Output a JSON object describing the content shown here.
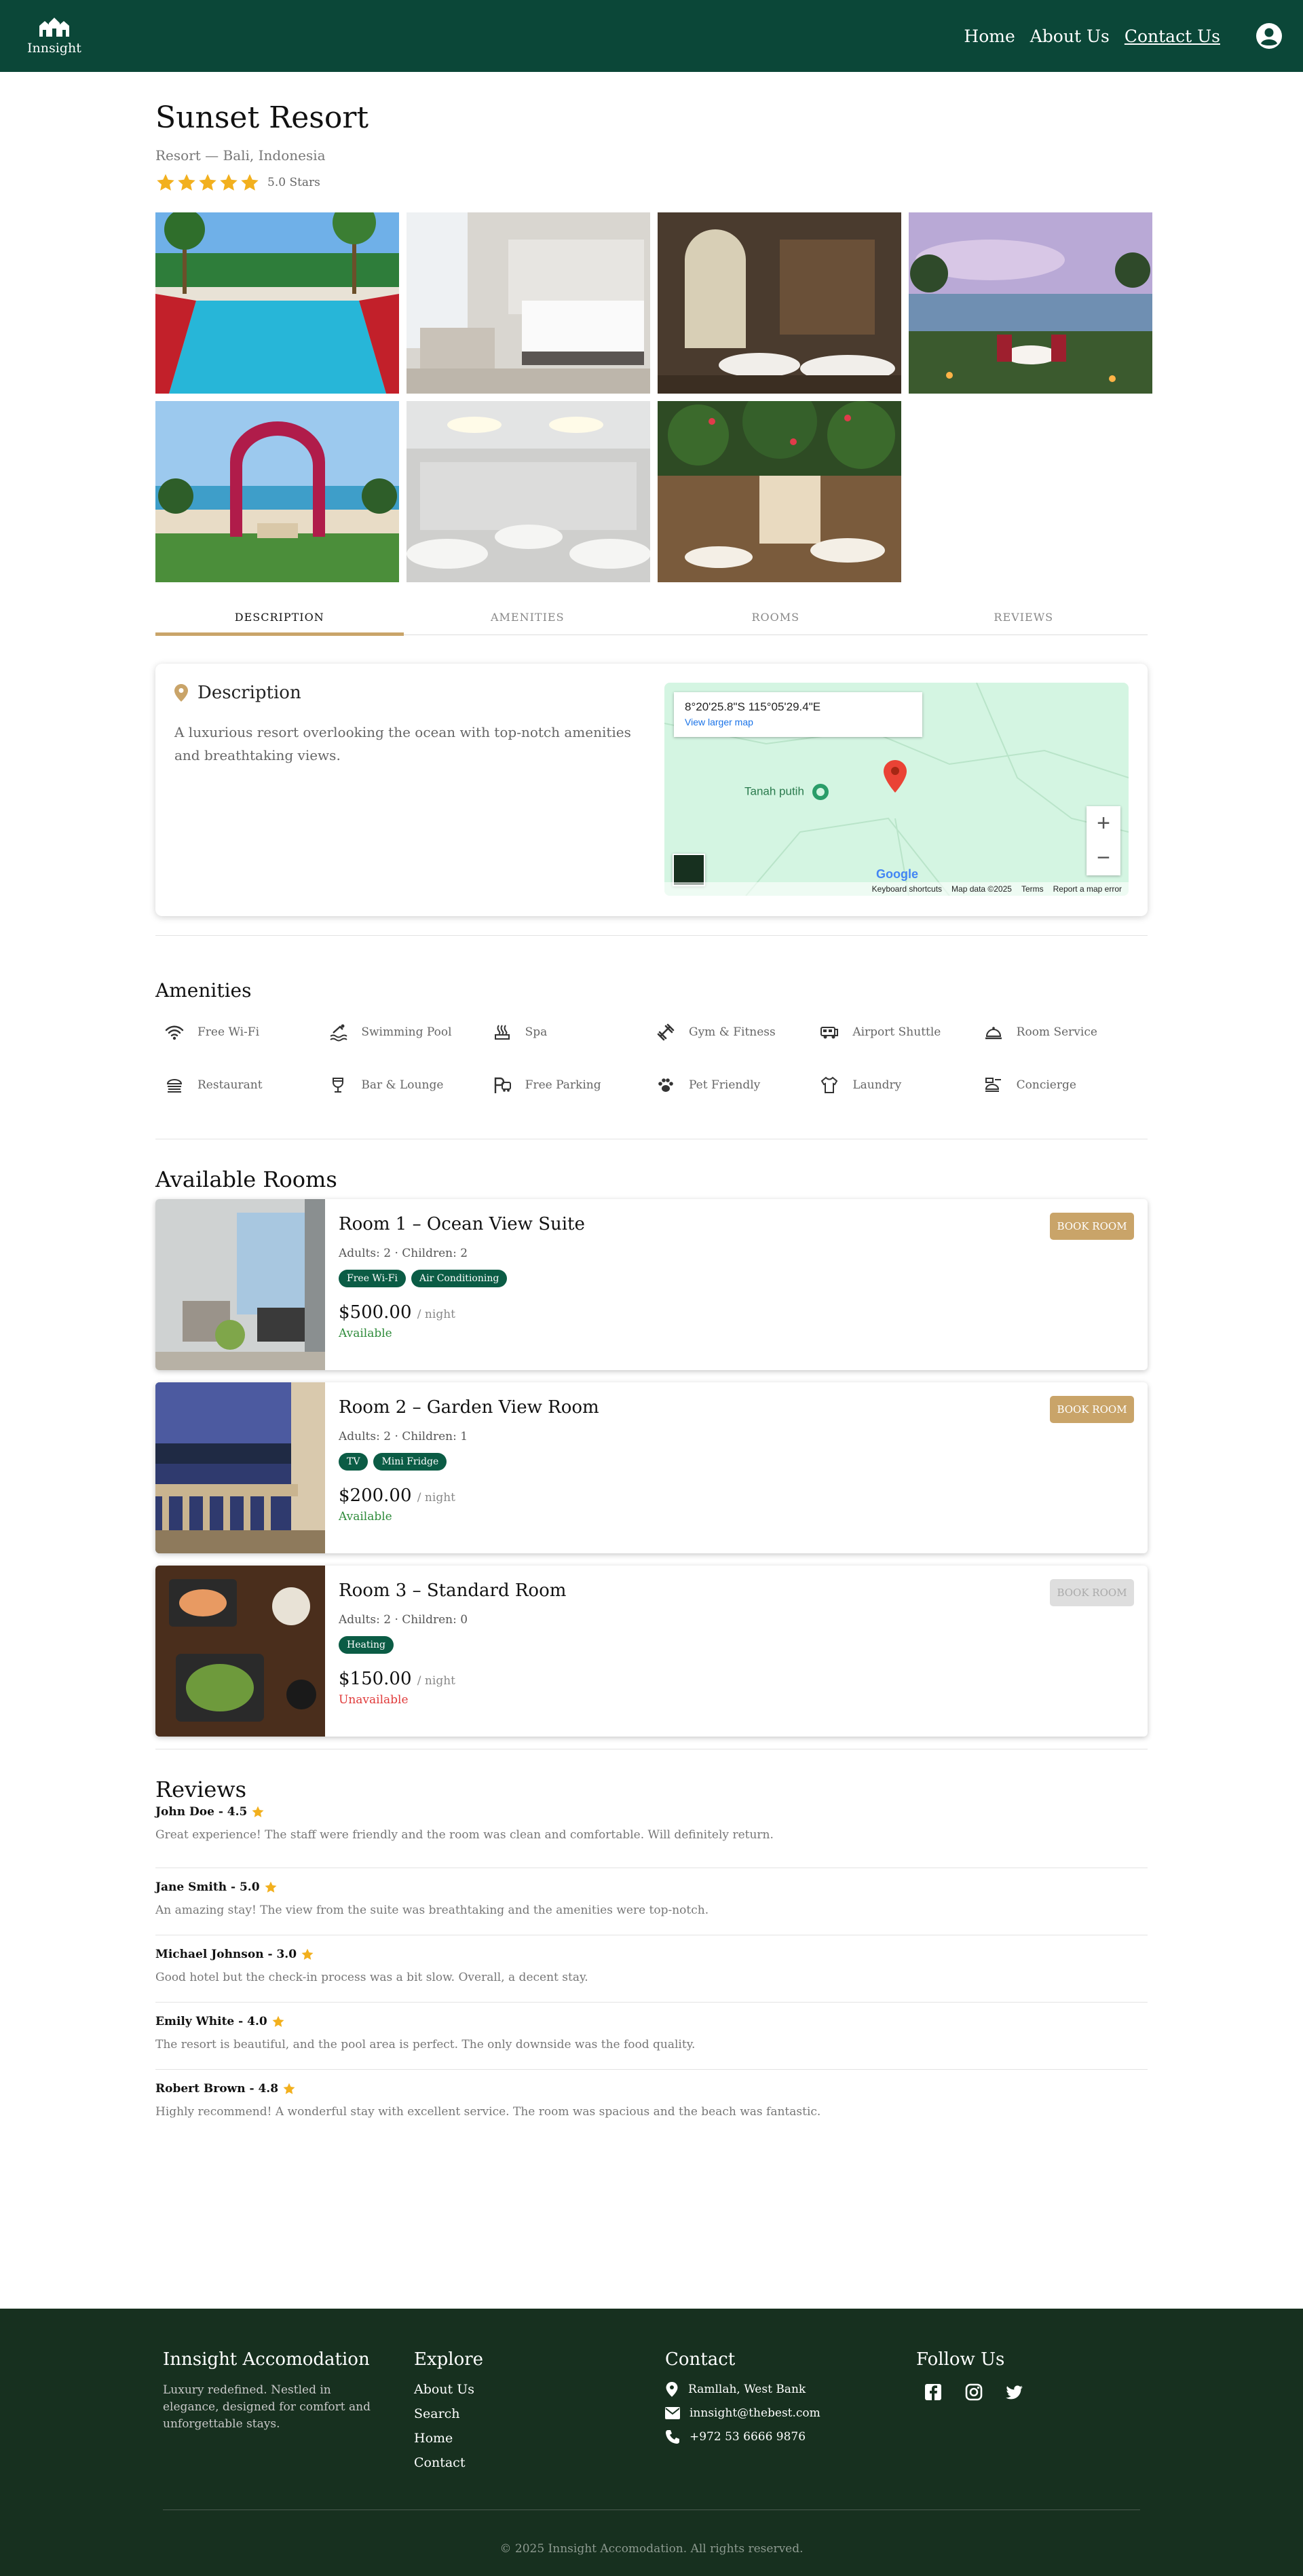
{
  "nav": {
    "brand": "Innsight",
    "links": [
      "Home",
      "About Us",
      "Contact Us"
    ]
  },
  "hotel": {
    "name": "Sunset Resort",
    "subtitle": "Resort — Bali, Indonesia",
    "rating": 5,
    "rating_label": "5.0 Stars"
  },
  "tabs": [
    "DESCRIPTION",
    "AMENITIES",
    "ROOMS",
    "REVIEWS"
  ],
  "description": {
    "heading": "Description",
    "text": "A luxurious resort overlooking the ocean with top-notch amenities and breathtaking views."
  },
  "map": {
    "coords": "8°20'25.8\"S 115°05'29.4\"E",
    "view_link": "View larger map",
    "place": "Tanah putih",
    "brand": "Google",
    "footer": [
      "Keyboard shortcuts",
      "Map data ©2025",
      "Terms",
      "Report a map error"
    ]
  },
  "amenities": {
    "heading": "Amenities",
    "items": [
      {
        "label": "Free Wi-Fi",
        "icon": "wifi-icon"
      },
      {
        "label": "Swimming Pool",
        "icon": "pool-icon"
      },
      {
        "label": "Spa",
        "icon": "spa-icon"
      },
      {
        "label": "Gym & Fitness",
        "icon": "dumbbell-icon"
      },
      {
        "label": "Airport Shuttle",
        "icon": "shuttle-icon"
      },
      {
        "label": "Room Service",
        "icon": "room-service-icon"
      },
      {
        "label": "Restaurant",
        "icon": "restaurant-icon"
      },
      {
        "label": "Bar & Lounge",
        "icon": "cocktail-icon"
      },
      {
        "label": "Free Parking",
        "icon": "parking-icon"
      },
      {
        "label": "Pet Friendly",
        "icon": "paw-icon"
      },
      {
        "label": "Laundry",
        "icon": "laundry-icon"
      },
      {
        "label": "Concierge",
        "icon": "concierge-icon"
      }
    ]
  },
  "rooms": {
    "heading": "Available Rooms",
    "items": [
      {
        "name": "Room 1 – Ocean View Suite",
        "occupancy": "Adults: 2 · Children: 2",
        "features": [
          "Free Wi-Fi",
          "Air Conditioning"
        ],
        "price": "$500.00",
        "per": "/ night",
        "status": "Available",
        "button": "BOOK ROOM"
      },
      {
        "name": "Room 2 – Garden View Room",
        "occupancy": "Adults: 2 · Children: 1",
        "features": [
          "TV",
          "Mini Fridge"
        ],
        "price": "$200.00",
        "per": "/ night",
        "status": "Available",
        "button": "BOOK ROOM"
      },
      {
        "name": "Room 3 – Standard Room",
        "occupancy": "Adults: 2 · Children: 0",
        "features": [
          "Heating"
        ],
        "price": "$150.00",
        "per": "/ night",
        "status": "Unavailable",
        "button": "BOOK ROOM"
      }
    ]
  },
  "reviews": {
    "heading": "Reviews",
    "items": [
      {
        "author": "John Doe - 4.5",
        "text": "Great experience! The staff were friendly and the room was clean and comfortable. Will definitely return."
      },
      {
        "author": "Jane Smith - 5.0",
        "text": "An amazing stay! The view from the suite was breathtaking and the amenities were top-notch."
      },
      {
        "author": "Michael Johnson - 3.0",
        "text": "Good hotel but the check-in process was a bit slow. Overall, a decent stay."
      },
      {
        "author": "Emily White - 4.0",
        "text": "The resort is beautiful, and the pool area is perfect. The only downside was the food quality."
      },
      {
        "author": "Robert Brown - 4.8",
        "text": "Highly recommend! A wonderful stay with excellent service. The room was spacious and the beach was fantastic."
      }
    ]
  },
  "footer": {
    "about_title": "Innsight Accomodation",
    "about_text": "Luxury redefined. Nestled in elegance, designed for comfort and unforgettable stays.",
    "explore_title": "Explore",
    "explore_links": [
      "About Us",
      "Search",
      "Home",
      "Contact"
    ],
    "contact_title": "Contact",
    "contact": {
      "address": "Ramllah, West Bank",
      "email": "innsight@thebest.com",
      "phone": "+972 53 6666 9876"
    },
    "follow_title": "Follow Us",
    "copyright": "© 2025 Innsight Accomodation. All rights reserved."
  },
  "colors": {
    "primary": "#0b4738",
    "accent": "#c9a469",
    "chip": "#0b5c45",
    "available": "#2e8b3a",
    "unavailable": "#e03a3a",
    "footer": "#17301f"
  }
}
